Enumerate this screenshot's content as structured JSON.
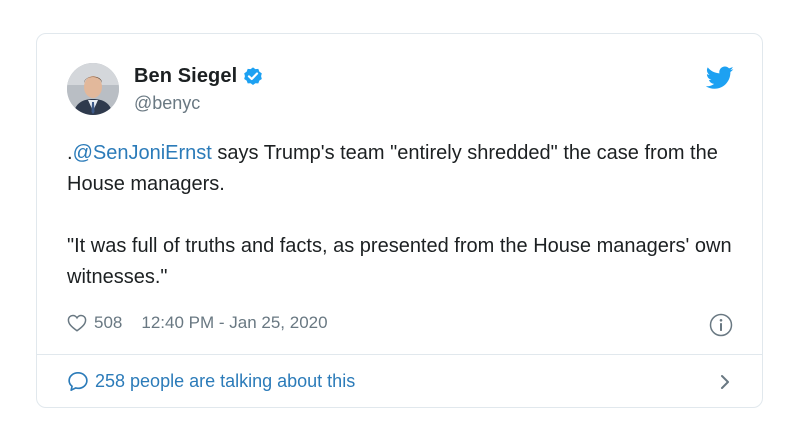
{
  "author": {
    "name": "Ben Siegel",
    "handle": "@benyc",
    "verified": true,
    "avatar_icon": "person-avatar"
  },
  "tweet": {
    "paragraph1": {
      "prefix": ".",
      "mention": "@SenJoniErnst",
      "text": " says Trump's team \"entirely shredded\" the case from the House managers."
    },
    "paragraph2": "\"It was full of truths and facts, as presented from the House managers' own witnesses.\""
  },
  "meta": {
    "likes": "508",
    "timestamp": "12:40 PM - Jan 25, 2020"
  },
  "footer": {
    "talking": "258 people are talking about this"
  },
  "colors": {
    "link": "#2b7bb9",
    "verified": "#1da1f2",
    "twitter_blue": "#1da1f2",
    "muted": "#697882",
    "border": "#e1e8ed"
  },
  "icons": {
    "brand": "twitter-bird-icon",
    "verified": "verified-badge-icon",
    "like": "heart-icon",
    "info": "info-icon",
    "comment": "speech-bubble-icon",
    "chevron": "chevron-right-icon"
  }
}
